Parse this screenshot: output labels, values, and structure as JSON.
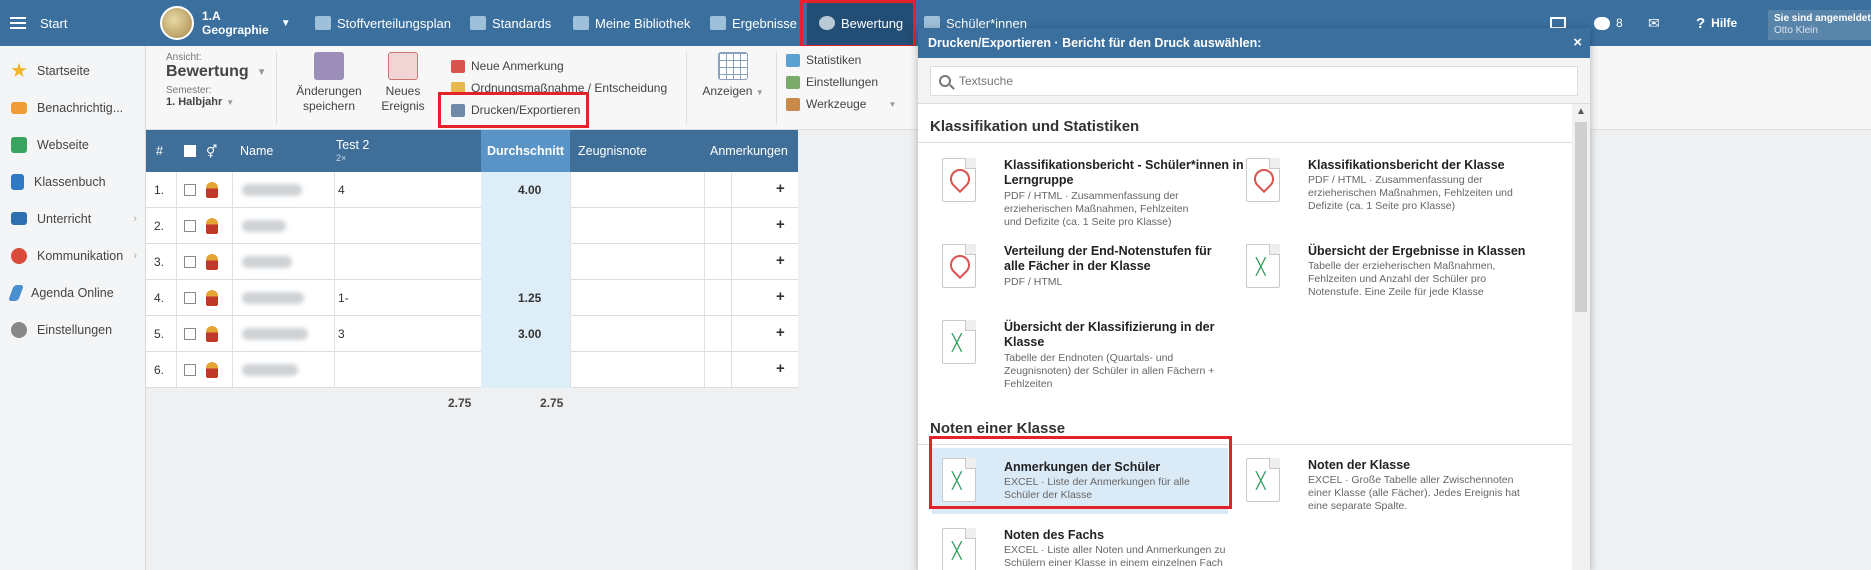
{
  "topbar": {
    "start_label": "Start",
    "class_name": "1.A",
    "class_subject": "Geographie",
    "nav": [
      {
        "label": "Stoffverteilungsplan"
      },
      {
        "label": "Standards"
      },
      {
        "label": "Meine Bibliothek"
      },
      {
        "label": "Ergebnisse"
      },
      {
        "label": "Bewertung"
      },
      {
        "label": "Schüler*innen"
      }
    ],
    "badge_count": "8",
    "help_label": "Hilfe",
    "user_line1": "Sie sind angemeldet",
    "user_line2": "Otto Klein"
  },
  "sidebar": {
    "items": [
      {
        "label": "Startseite",
        "icon": "star-icon",
        "color": "#f0b429"
      },
      {
        "label": "Benachrichtig...",
        "icon": "envelope-icon",
        "color": "#f39c35"
      },
      {
        "label": "Webseite",
        "icon": "home-icon",
        "color": "#3aa35f"
      },
      {
        "label": "Klassenbuch",
        "icon": "book-icon",
        "color": "#2f78c4"
      },
      {
        "label": "Unterricht",
        "icon": "board-icon",
        "color": "#2f6fb0"
      },
      {
        "label": "Kommunikation",
        "icon": "chat-icon",
        "color": "#d94b3a"
      },
      {
        "label": "Agenda Online",
        "icon": "pen-icon",
        "color": "#4a8fd0"
      },
      {
        "label": "Einstellungen",
        "icon": "gear-icon",
        "color": "#888888"
      }
    ]
  },
  "toolbar": {
    "view_label": "Ansicht:",
    "view_value": "Bewertung",
    "semester_label": "Semester:",
    "semester_value": "1. Halbjahr",
    "save_line1": "Änderungen",
    "save_line2": "speichern",
    "new_event_line1": "Neues",
    "new_event_line2": "Ereignis",
    "new_note": "Neue Anmerkung",
    "order_measure": "Ordnungsmaßnahme / Entscheidung",
    "print_export": "Drucken/Exportieren",
    "show_label": "Anzeigen",
    "statistics": "Statistiken",
    "settings": "Einstellungen",
    "tools": "Werkzeuge"
  },
  "grades": {
    "headers": {
      "num": "#",
      "name": "Name",
      "test": "Test 2",
      "test_sub": "2×",
      "average": "Durchschnitt",
      "report_grade": "Zeugnisnote",
      "remarks": "Anmerkungen"
    },
    "rows": [
      {
        "num": "1.",
        "test": "4",
        "avg": "4.00"
      },
      {
        "num": "2.",
        "test": "",
        "avg": ""
      },
      {
        "num": "3.",
        "test": "",
        "avg": ""
      },
      {
        "num": "4.",
        "test": "1-",
        "avg": "1.25"
      },
      {
        "num": "5.",
        "test": "3",
        "avg": "3.00"
      },
      {
        "num": "6.",
        "test": "",
        "avg": ""
      }
    ],
    "footer_test": "2.75",
    "footer_avg": "2.75"
  },
  "modal": {
    "title": "Drucken/Exportieren · Bericht für den Druck auswählen:",
    "search_placeholder": "Textsuche",
    "sections": [
      {
        "title": "Klassifikation und Statistiken",
        "reports": [
          {
            "title": "Klassifikationsbericht - Schüler*innen in Lerngruppe",
            "desc": "PDF / HTML · Zusammenfassung der erzieherischen Maßnahmen, Fehlzeiten und Defizite (ca. 1 Seite pro Klasse)",
            "type": "pdf"
          },
          {
            "title": "Klassifikationsbericht der Klasse",
            "desc": "PDF / HTML · Zusammenfassung der erzieherischen Maßnahmen, Fehlzeiten und Defizite (ca. 1 Seite pro Klasse)",
            "type": "pdf"
          },
          {
            "title": "Verteilung der End-Notenstufen für alle Fächer in der Klasse",
            "desc": "PDF / HTML",
            "type": "pdf"
          },
          {
            "title": "Übersicht der Ergebnisse in Klassen",
            "desc": "Tabelle der erzieherischen Maßnahmen, Fehlzeiten und Anzahl der Schüler pro Notenstufe. Eine Zeile für jede Klasse",
            "type": "xls"
          },
          {
            "title": "Übersicht der Klassifizierung in der Klasse",
            "desc": "Tabelle der Endnoten (Quartals- und Zeugnisnoten) der Schüler in allen Fächern + Fehlzeiten",
            "type": "xls"
          }
        ]
      },
      {
        "title": "Noten einer Klasse",
        "reports": [
          {
            "title": "Anmerkungen der Schüler",
            "desc": "EXCEL · Liste der Anmerkungen für alle Schüler der Klasse",
            "type": "xls"
          },
          {
            "title": "Noten der Klasse",
            "desc": "EXCEL · Große Tabelle aller Zwischennoten einer Klasse (alle Fächer). Jedes Ereignis hat eine separate Spalte.",
            "type": "xls"
          },
          {
            "title": "Noten des Fachs",
            "desc": "EXCEL · Liste aller Noten und Anmerkungen zu Schülern einer Klasse in einem einzelnen Fach",
            "type": "xls"
          }
        ]
      }
    ]
  },
  "colors": {
    "topbar": "#3a6f9e",
    "active_nav": "#224d74",
    "highlight": "#e2232a",
    "table_header": "#3f6f98",
    "avg_column": "#ddeef8"
  }
}
